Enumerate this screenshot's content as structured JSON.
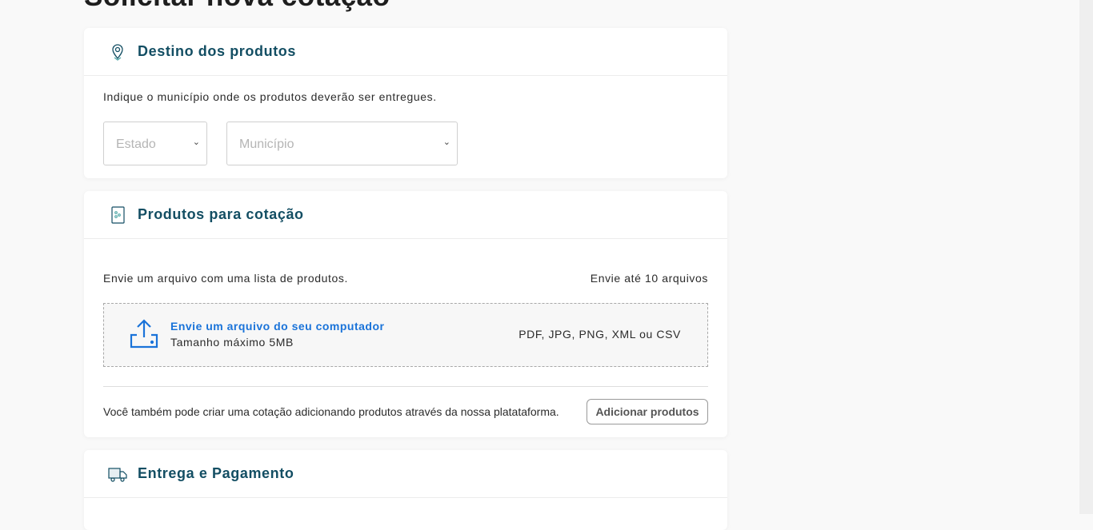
{
  "page": {
    "title": "Solicitar nova cotação"
  },
  "destino": {
    "title": "Destino dos produtos",
    "icon": "map-pin-icon",
    "description": "Indique o município onde os produtos deverão ser entregues.",
    "estado_placeholder": "Estado",
    "municipio_placeholder": "Município"
  },
  "produtos": {
    "title": "Produtos para cotação",
    "icon": "product-list-icon",
    "description": "Envie um arquivo com uma lista de produtos.",
    "limit": "Envie até 10 arquivos",
    "upload_title": "Envie um arquivo do seu computador",
    "upload_size": "Tamanho máximo 5MB",
    "formats": "PDF, JPG, PNG, XML ou CSV",
    "alt_text": "Você também pode criar uma cotação adicionando produtos através da nossa platataforma.",
    "add_button": "Adicionar produtos"
  },
  "entrega": {
    "title": "Entrega e Pagamento",
    "icon": "truck-icon"
  },
  "colors": {
    "heading": "#134e63",
    "accent": "#1a73d9"
  }
}
